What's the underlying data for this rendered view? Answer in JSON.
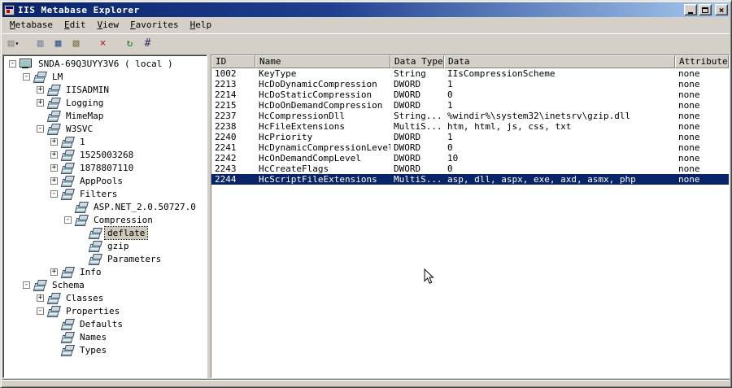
{
  "window": {
    "title": "IIS Metabase Explorer"
  },
  "menu": {
    "items": [
      {
        "label": "Metabase"
      },
      {
        "label": "Edit"
      },
      {
        "label": "View"
      },
      {
        "label": "Favorites"
      },
      {
        "label": "Help"
      }
    ]
  },
  "toolbar": {
    "buttons": [
      {
        "name": "new-key-button",
        "glyph": "▤",
        "color": "#8a8a8a",
        "dropdown_glyph": "▾"
      },
      {
        "name": "new-value-button",
        "glyph": "▥",
        "color": "#6a7a9a",
        "gap": true
      },
      {
        "name": "copy-button",
        "glyph": "▦",
        "color": "#3a5a8a"
      },
      {
        "name": "paste-button",
        "glyph": "▧",
        "color": "#7a6a3a"
      },
      {
        "name": "delete-button",
        "glyph": "×",
        "color": "#b22222",
        "gap": true
      },
      {
        "name": "refresh-button",
        "glyph": "↻",
        "color": "#1a7a1a",
        "gap": true
      },
      {
        "name": "connect-button",
        "glyph": "#",
        "color": "#333366"
      }
    ]
  },
  "tree": {
    "nodes": [
      {
        "label": "SNDA-69Q3UYY3V6 ( local )",
        "depth": 0,
        "expander": "-",
        "icon": "computer-icon"
      },
      {
        "label": "LM",
        "depth": 1,
        "expander": "-",
        "icon": "keys-icon"
      },
      {
        "label": "IISADMIN",
        "depth": 2,
        "expander": "+",
        "icon": "keys-icon"
      },
      {
        "label": "Logging",
        "depth": 2,
        "expander": "+",
        "icon": "keys-icon"
      },
      {
        "label": "MimeMap",
        "depth": 2,
        "expander": "",
        "icon": "keys-icon"
      },
      {
        "label": "W3SVC",
        "depth": 2,
        "expander": "-",
        "icon": "keys-icon"
      },
      {
        "label": "1",
        "depth": 3,
        "expander": "+",
        "icon": "keys-icon"
      },
      {
        "label": "1525003268",
        "depth": 3,
        "expander": "+",
        "icon": "keys-icon"
      },
      {
        "label": "1878807110",
        "depth": 3,
        "expander": "+",
        "icon": "keys-icon"
      },
      {
        "label": "AppPools",
        "depth": 3,
        "expander": "+",
        "icon": "keys-icon"
      },
      {
        "label": "Filters",
        "depth": 3,
        "expander": "-",
        "icon": "keys-icon"
      },
      {
        "label": "ASP.NET_2.0.50727.0",
        "depth": 4,
        "expander": "",
        "icon": "keys-icon"
      },
      {
        "label": "Compression",
        "depth": 4,
        "expander": "-",
        "icon": "keys-icon"
      },
      {
        "label": "deflate",
        "depth": 5,
        "expander": "",
        "icon": "keys-icon",
        "selected": true
      },
      {
        "label": "gzip",
        "depth": 5,
        "expander": "",
        "icon": "keys-icon"
      },
      {
        "label": "Parameters",
        "depth": 5,
        "expander": "",
        "icon": "keys-icon"
      },
      {
        "label": "Info",
        "depth": 3,
        "expander": "+",
        "icon": "keys-icon"
      },
      {
        "label": "Schema",
        "depth": 1,
        "expander": "-",
        "icon": "keys-icon"
      },
      {
        "label": "Classes",
        "depth": 2,
        "expander": "+",
        "icon": "keys-icon"
      },
      {
        "label": "Properties",
        "depth": 2,
        "expander": "-",
        "icon": "keys-icon"
      },
      {
        "label": "Defaults",
        "depth": 3,
        "expander": "",
        "icon": "keys-icon"
      },
      {
        "label": "Names",
        "depth": 3,
        "expander": "",
        "icon": "keys-icon"
      },
      {
        "label": "Types",
        "depth": 3,
        "expander": "",
        "icon": "keys-icon"
      }
    ]
  },
  "list": {
    "columns": [
      "ID",
      "Name",
      "Data Type",
      "Data",
      "Attributes"
    ],
    "rows": [
      {
        "id": "1002",
        "name": "KeyType",
        "type": "String",
        "data": "IIsCompressionScheme",
        "attributes": "none"
      },
      {
        "id": "2213",
        "name": "HcDoDynamicCompression",
        "type": "DWORD",
        "data": "1",
        "attributes": "none"
      },
      {
        "id": "2214",
        "name": "HcDoStaticCompression",
        "type": "DWORD",
        "data": "0",
        "attributes": "none"
      },
      {
        "id": "2215",
        "name": "HcDoOnDemandCompression",
        "type": "DWORD",
        "data": "1",
        "attributes": "none"
      },
      {
        "id": "2237",
        "name": "HcCompressionDll",
        "type": "String...",
        "data": "%windir%\\system32\\inetsrv\\gzip.dll",
        "attributes": "none"
      },
      {
        "id": "2238",
        "name": "HcFileExtensions",
        "type": "MultiS...",
        "data": "htm, html, js, css, txt",
        "attributes": "none"
      },
      {
        "id": "2240",
        "name": "HcPriority",
        "type": "DWORD",
        "data": "1",
        "attributes": "none"
      },
      {
        "id": "2241",
        "name": "HcDynamicCompressionLevel",
        "type": "DWORD",
        "data": "0",
        "attributes": "none"
      },
      {
        "id": "2242",
        "name": "HcOnDemandCompLevel",
        "type": "DWORD",
        "data": "10",
        "attributes": "none"
      },
      {
        "id": "2243",
        "name": "HcCreateFlags",
        "type": "DWORD",
        "data": "0",
        "attributes": "none"
      },
      {
        "id": "2244",
        "name": "HcScriptFileExtensions",
        "type": "MultiS...",
        "data": "asp, dll, aspx, exe, axd, asmx, php",
        "attributes": "none",
        "selected": true
      }
    ]
  },
  "status": {
    "text": ""
  }
}
